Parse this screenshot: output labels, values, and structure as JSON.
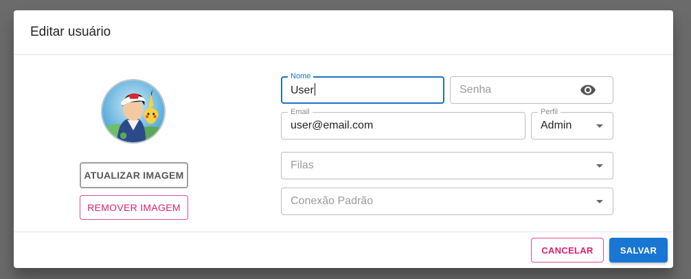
{
  "dialog": {
    "title": "Editar usuário"
  },
  "avatar": {
    "alt": "avatar"
  },
  "buttons": {
    "update_image": "ATUALIZAR IMAGEM",
    "remove_image": "REMOVER IMAGEM",
    "cancel": "CANCELAR",
    "save": "SALVAR"
  },
  "form": {
    "name": {
      "label": "Nome",
      "value": "User"
    },
    "password": {
      "placeholder": "Senha"
    },
    "email": {
      "label": "Email",
      "value": "user@email.com"
    },
    "profile": {
      "label": "Perfil",
      "value": "Admin"
    },
    "queues": {
      "placeholder": "Filas"
    },
    "default_connection": {
      "placeholder": "Conexão Padrão"
    }
  },
  "icons": {
    "password_toggle": "eye-icon",
    "dropdown": "arrow-drop-down-icon"
  },
  "colors": {
    "primary": "#1976d2",
    "secondary": "#dc1e6e",
    "overlay": "#6b6b6b"
  }
}
